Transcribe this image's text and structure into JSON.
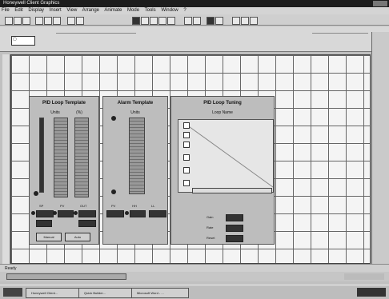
{
  "window": {
    "title": "Honeywell Client Graphics"
  },
  "menu": [
    "File",
    "Edit",
    "Display",
    "Insert",
    "View",
    "Arrange",
    "Animate",
    "Mode",
    "Tools",
    "Window",
    "?"
  ],
  "pid_panel": {
    "title": "PID Loop Template",
    "col1": "Units",
    "col2": "(%)",
    "labels": [
      "SP",
      "PV",
      "OUT"
    ],
    "btn_left": "Manual",
    "btn_right": "Auto"
  },
  "alarm_panel": {
    "title": "Alarm Template",
    "col1": "Units",
    "labels": [
      "PV",
      "HH",
      "LL"
    ]
  },
  "tune_panel": {
    "title": "PID Loop Tuning",
    "subtitle": "Loop Name",
    "params": [
      "Gain",
      "Rate",
      "Reset"
    ]
  },
  "status": {
    "left": "Ready"
  },
  "taskbar": [
    "Honeywell Client...",
    "Quick Builder...",
    "Microsoft Word - ..."
  ]
}
